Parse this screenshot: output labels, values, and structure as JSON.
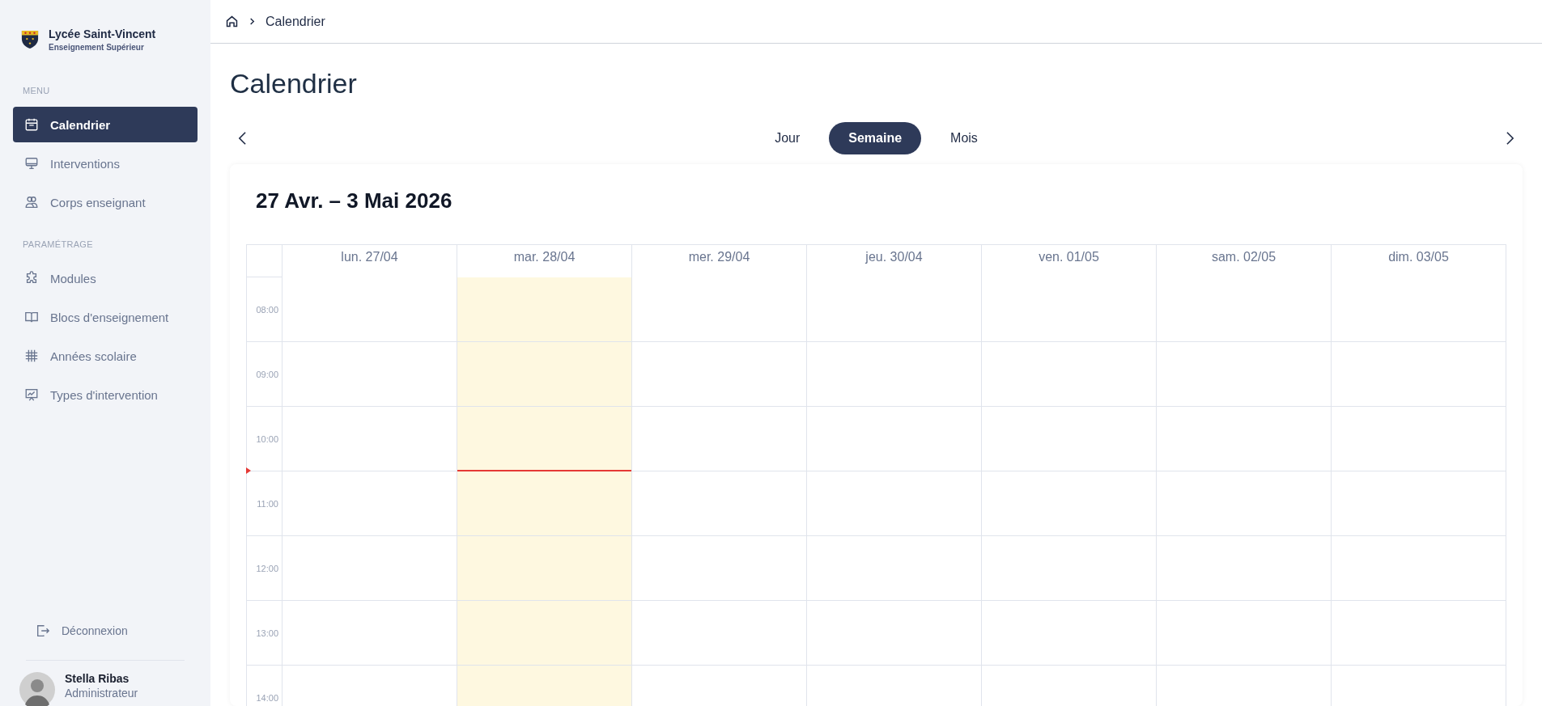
{
  "sidebar": {
    "brand": {
      "name": "Lycée Saint-Vincent",
      "subtitle": "Enseignement Supérieur"
    },
    "sections": [
      {
        "label": "MENU",
        "items": [
          {
            "label": "Calendrier",
            "selected": true
          },
          {
            "label": "Interventions",
            "selected": false
          },
          {
            "label": "Corps enseignant",
            "selected": false
          }
        ]
      },
      {
        "label": "PARAMÉTRAGE",
        "items": [
          {
            "label": "Modules",
            "selected": false
          },
          {
            "label": "Blocs d'enseignement",
            "selected": false
          },
          {
            "label": "Années scolaire",
            "selected": false
          },
          {
            "label": "Types d'intervention",
            "selected": false
          }
        ]
      }
    ],
    "logout": "Déconnexion",
    "user": {
      "name": "Stella Ribas",
      "role": "Administrateur"
    }
  },
  "breadcrumb": [
    "Calendrier"
  ],
  "page_title": "Calendrier",
  "views": [
    {
      "label": "Jour",
      "selected": false
    },
    {
      "label": "Semaine",
      "selected": true
    },
    {
      "label": "Mois",
      "selected": false
    }
  ],
  "calendar": {
    "range": "27 Avr. – 3 Mai 2026",
    "days": [
      {
        "label": "lun. 27/04",
        "today": false
      },
      {
        "label": "mar. 28/04",
        "today": true
      },
      {
        "label": "mer. 29/04",
        "today": false
      },
      {
        "label": "jeu. 30/04",
        "today": false
      },
      {
        "label": "ven. 01/05",
        "today": false
      },
      {
        "label": "sam. 02/05",
        "today": false
      },
      {
        "label": "dim. 03/05",
        "today": false
      }
    ],
    "hours": [
      {
        "label": "08:00",
        "now": false
      },
      {
        "label": "09:00",
        "now": false
      },
      {
        "label": "10:00",
        "now": true
      },
      {
        "label": "11:00",
        "now": false
      },
      {
        "label": "12:00",
        "now": false
      },
      {
        "label": "13:00",
        "now": false
      },
      {
        "label": "14:00",
        "now": false
      }
    ]
  }
}
